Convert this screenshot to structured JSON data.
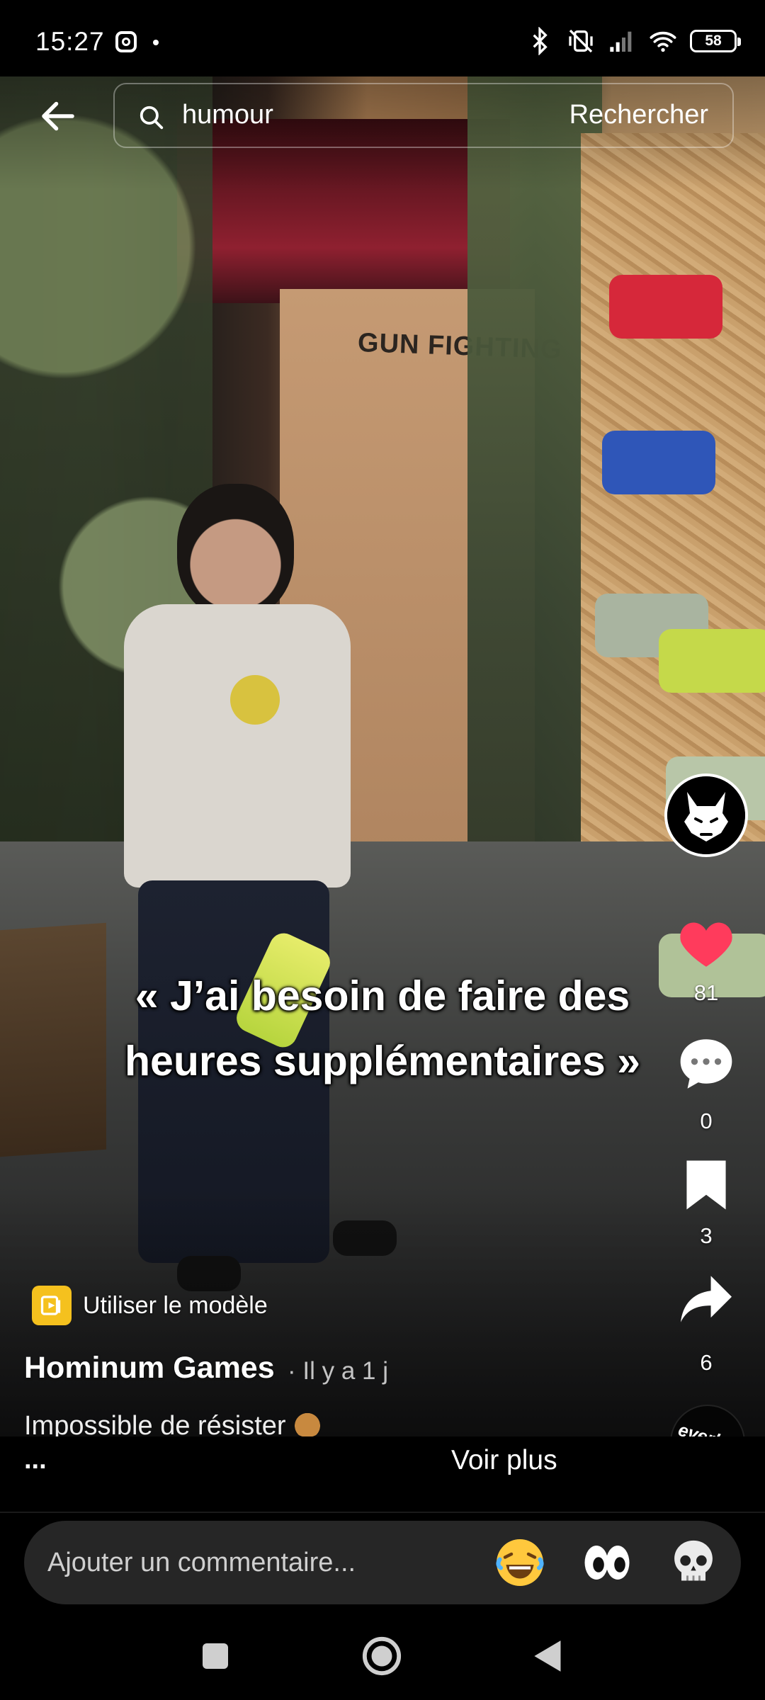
{
  "status_bar": {
    "time": "15:27",
    "battery": "58",
    "icons": [
      "instagram-icon",
      "bluetooth-icon",
      "vibrate-off-icon",
      "signal-icon",
      "wifi-icon",
      "battery-icon"
    ]
  },
  "search": {
    "query": "humour",
    "submit_label": "Rechercher"
  },
  "video": {
    "caption_line1": "« J’ai besoin de faire des",
    "caption_line2": "heures supplémentaires »",
    "scene_sign": "GUN FIGHTING"
  },
  "actions": {
    "likes": "81",
    "comments": "0",
    "saves": "3",
    "shares": "6",
    "like_color": "#ff3b5c"
  },
  "music": {
    "label": "everbowl"
  },
  "post": {
    "template_label": "Utiliser le modèle",
    "author": "Hominum Games",
    "timestamp": "· Il y a 1 j",
    "description": "Impossible de résister",
    "ellipsis": "...",
    "see_more": "Voir plus"
  },
  "comment": {
    "placeholder": "Ajouter un commentaire...",
    "quick_reactions": [
      "laughing-emoji-icon",
      "eyes-emoji-icon",
      "skull-emoji-icon"
    ]
  },
  "navigation": {
    "buttons": [
      "recent-apps-icon",
      "home-icon",
      "back-icon"
    ]
  }
}
